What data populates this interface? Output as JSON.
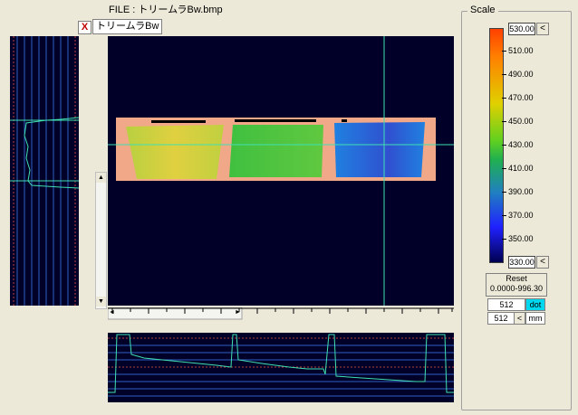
{
  "file_label": "FILE :    トリームラBw.bmp",
  "tab": {
    "close_glyph": "X",
    "label": "トリームラBw"
  },
  "scale": {
    "title": "Scale",
    "max_value": "530.00",
    "min_value": "330.00",
    "labels": [
      "510.00",
      "490.00",
      "470.00",
      "450.00",
      "430.00",
      "410.00",
      "390.00",
      "370.00",
      "350.00"
    ],
    "arrow_glyph": "<"
  },
  "reset": {
    "label": "Reset",
    "range": "0.0000-996.30"
  },
  "units": {
    "w": "512",
    "dot": "dot",
    "h": "512",
    "arrow": "<",
    "mm": "mm"
  },
  "scrollbar": {
    "up": "▲",
    "down": "▼",
    "left": "◄",
    "right": "►"
  },
  "colors": {
    "background": "#000028",
    "trace": "#40e0b0",
    "hot": "#ff4000",
    "cold": "#000050"
  }
}
